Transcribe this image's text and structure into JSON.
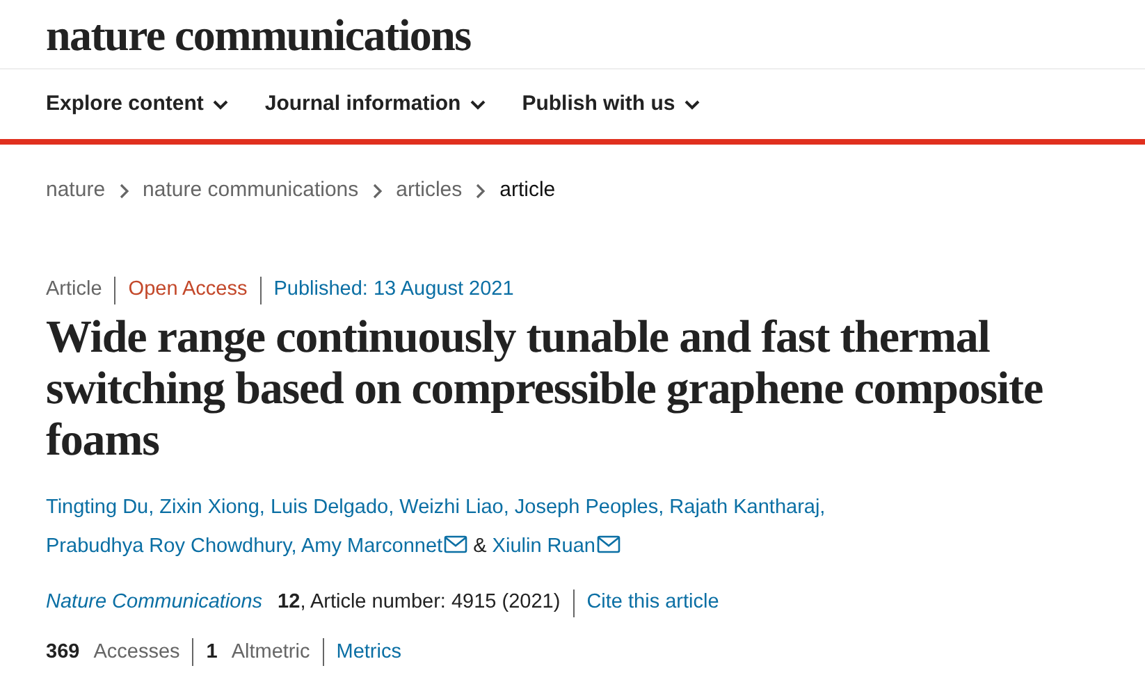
{
  "logo": "nature communications",
  "nav": [
    {
      "label": "Explore content"
    },
    {
      "label": "Journal information"
    },
    {
      "label": "Publish with us"
    }
  ],
  "breadcrumbs": [
    {
      "label": "nature",
      "selected": false
    },
    {
      "label": "nature communications",
      "selected": false
    },
    {
      "label": "articles",
      "selected": false
    },
    {
      "label": "article",
      "selected": true
    }
  ],
  "meta": [
    {
      "kind": "type",
      "text": "Article"
    },
    {
      "kind": "access",
      "text": "Open Access"
    },
    {
      "kind": "date",
      "text": "Published: 13 August 2021"
    }
  ],
  "title": "Wide range continuously tunable and fast thermal switching based on compressible graphene composite foams",
  "authors": [
    {
      "kind": "author",
      "name": "Tingting Du,",
      "email": false
    },
    {
      "kind": "author",
      "name": "Zixin Xiong,",
      "email": false
    },
    {
      "kind": "author",
      "name": "Luis Delgado,",
      "email": false
    },
    {
      "kind": "author",
      "name": "Weizhi Liao,",
      "email": false
    },
    {
      "kind": "author",
      "name": "Joseph Peoples,",
      "email": false
    },
    {
      "kind": "author",
      "name": "Rajath Kantharaj,",
      "email": false
    },
    {
      "kind": "author",
      "name": "Prabudhya Roy Chowdhury,",
      "email": false
    },
    {
      "kind": "author",
      "name": "Amy Marconnet",
      "email": true
    },
    {
      "kind": "conjunction",
      "name": "&"
    },
    {
      "kind": "author",
      "name": "Xiulin Ruan",
      "email": true
    }
  ],
  "citation": {
    "journal": "Nature Communications",
    "details": "**12**, Article number: 4915 (2021)",
    "cite_link": "Cite this article"
  },
  "metrics": [
    {
      "kind": "stat",
      "count": "369",
      "label": "Accesses"
    },
    {
      "kind": "stat",
      "count": "1",
      "label": "Altmetric"
    },
    {
      "kind": "link",
      "label": "Metrics"
    }
  ]
}
